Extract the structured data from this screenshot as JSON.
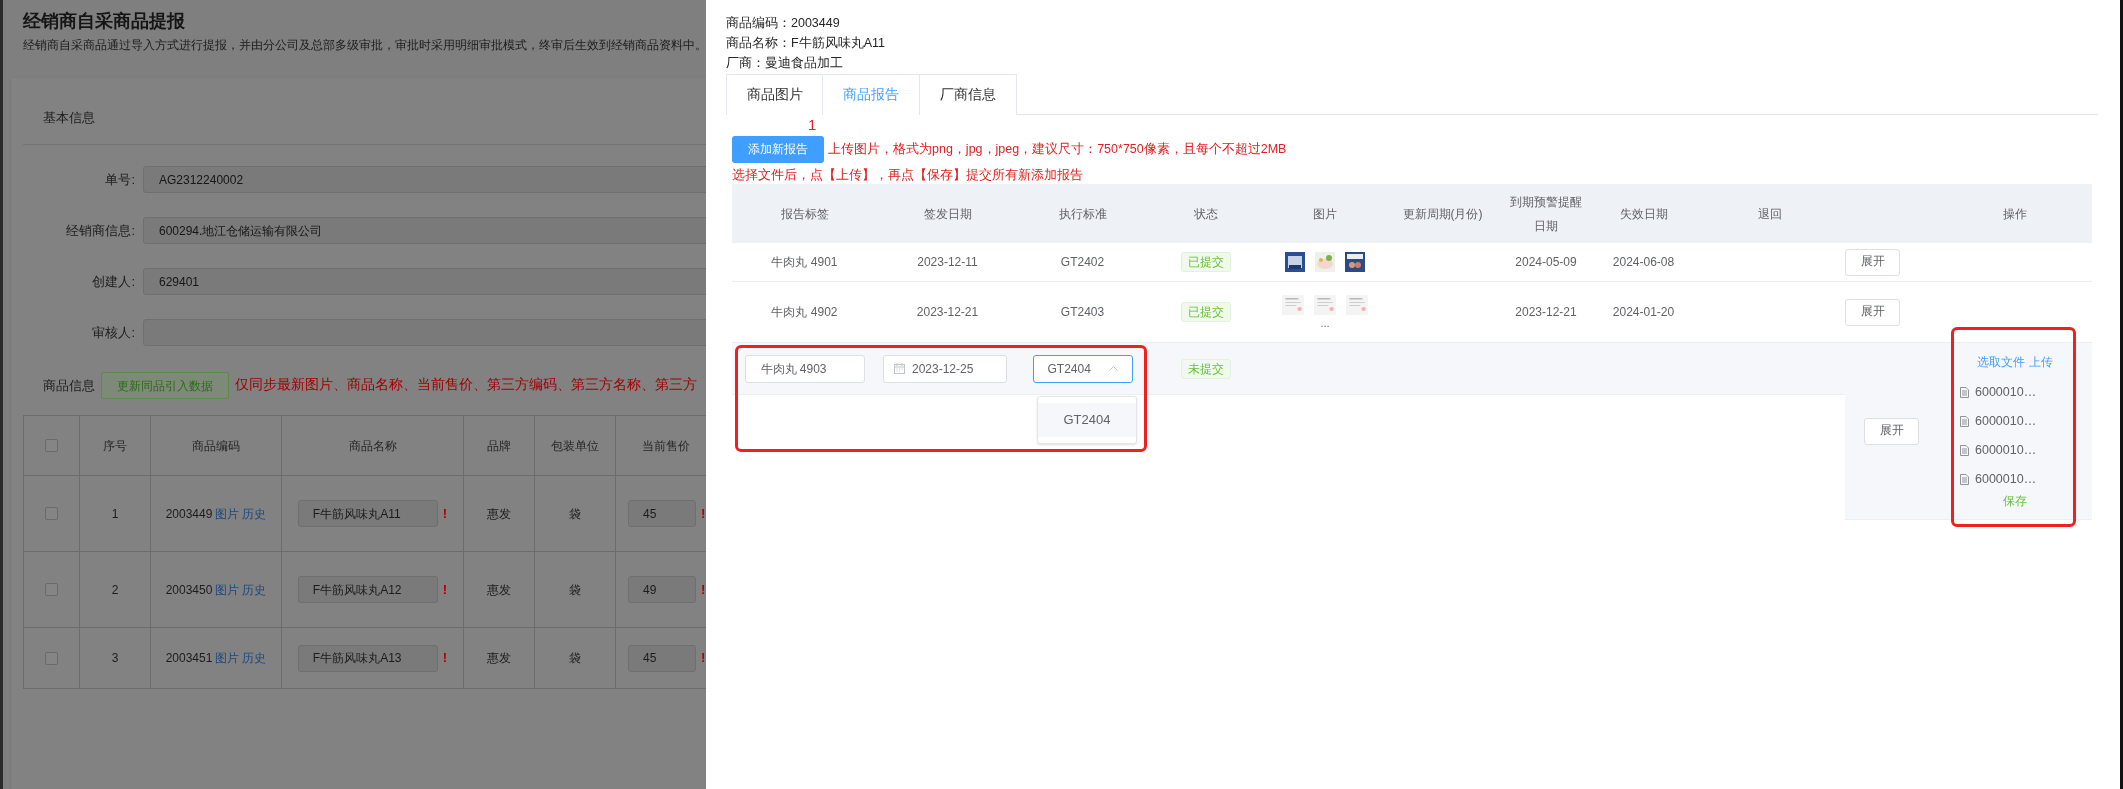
{
  "page": {
    "title": "经销商自采商品提报",
    "description": "经销商自采商品通过导入方式进行提报，并由分公司及总部多级审批，审批时采用明细审批模式，终审后生效到经销商品资料中。"
  },
  "basic_info": {
    "heading": "基本信息",
    "fields": [
      {
        "label": "单号:",
        "value": "AG2312240002"
      },
      {
        "label": "经销商信息:",
        "value": "600294.地江仓储运输有限公司"
      },
      {
        "label": "创建人:",
        "value": "629401"
      },
      {
        "label": "审核人:"
      }
    ]
  },
  "goods_info": {
    "label": "商品信息",
    "update_button": "更新同品引入数据",
    "notice": "仅同步最新图片、商品名称、当前售价、第三方编码、第三方名称、第三方"
  },
  "goods_table": {
    "all_checked": false,
    "columns": [
      "序号",
      "商品编码",
      "商品名称",
      "品牌",
      "包装单位",
      "当前售价"
    ],
    "rows": [
      {
        "checked": false,
        "index": "1",
        "code": "2003449",
        "links": [
          "图片",
          "历史"
        ],
        "name": "F牛筋风味丸A11",
        "name_mark": "!",
        "brand": "惠发",
        "unit": "袋",
        "price": "45",
        "price_mark": "!"
      },
      {
        "checked": false,
        "index": "2",
        "code": "2003450",
        "links": [
          "图片",
          "历史"
        ],
        "name": "F牛筋风味丸A12",
        "name_mark": "!",
        "brand": "惠发",
        "unit": "袋",
        "price": "49",
        "price_mark": "!"
      },
      {
        "checked": false,
        "index": "3",
        "code": "2003451",
        "links": [
          "图片",
          "历史"
        ],
        "name": "F牛筋风味丸A13",
        "name_mark": "!",
        "brand": "惠发",
        "unit": "袋",
        "price": "45",
        "price_mark": "!"
      }
    ]
  },
  "drawer": {
    "info": [
      {
        "label": "商品编码：",
        "value": "2003449"
      },
      {
        "label": "商品名称：",
        "value": "F牛筋风味丸A11"
      },
      {
        "label": "厂商：",
        "value": "曼迪食品加工"
      }
    ],
    "tabs": [
      {
        "label": "商品图片",
        "selected": false
      },
      {
        "label": "商品报告",
        "selected": true
      },
      {
        "label": "厂商信息",
        "selected": false
      }
    ],
    "add_button": "添加新报告",
    "step_number": "1",
    "hints": [
      "上传图片，格式为png，jpg，jpeg，建议尺寸：750*750像素，且每个不超过2MB",
      "选择文件后，点【上传】，再点【保存】提交所有新添加报告"
    ],
    "report_table": {
      "columns": [
        "报告标签",
        "签发日期",
        "执行标准",
        "状态",
        "图片",
        "更新周期(月份)",
        "到期预警提醒日期",
        "失效日期",
        "退回",
        "",
        "操作"
      ],
      "rows": [
        {
          "kind": "saved",
          "label": "牛肉丸 4901",
          "date": "2023-12-11",
          "standard": "GT2402",
          "status": "已提交",
          "warning_date": "2024-05-09",
          "expiry_date": "2024-06-08",
          "expand_button": "展开"
        },
        {
          "kind": "saved",
          "label": "牛肉丸 4902",
          "date": "2023-12-21",
          "standard": "GT2403",
          "status": "已提交",
          "more": "...",
          "warning_date": "2023-12-21",
          "expiry_date": "2024-01-20",
          "expand_button": "展开"
        },
        {
          "kind": "editing",
          "label": "牛肉丸 4903",
          "date": "2023-12-25",
          "standard": "GT2404",
          "standard_open": true,
          "options": [
            {
              "label": "GT2404",
              "selected": true
            }
          ],
          "status": "未提交",
          "expand_button": "展开",
          "upload_links": [
            "选取文件",
            "上传"
          ],
          "files": [
            "6000010…",
            "6000010…",
            "6000010…",
            "6000010…"
          ],
          "save": "保存"
        }
      ]
    }
  }
}
